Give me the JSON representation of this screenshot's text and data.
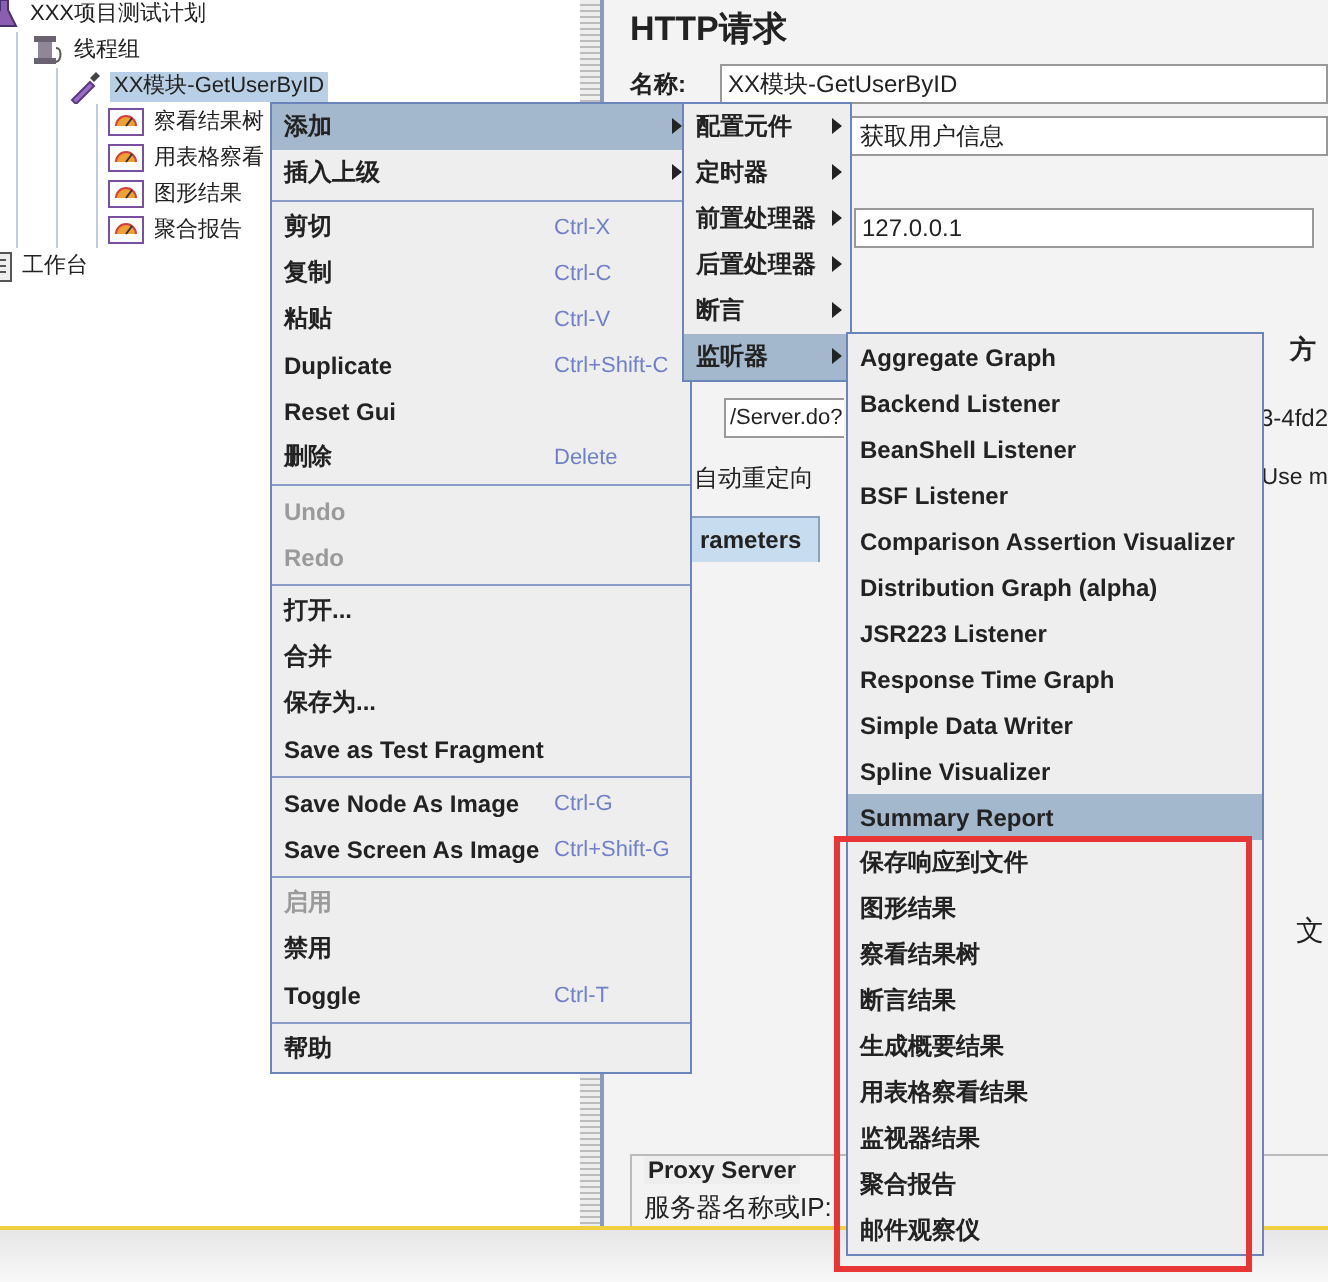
{
  "tree": [
    {
      "label": "XXX项目测试计划",
      "kind": "plan",
      "selected": false,
      "children": [
        {
          "label": "线程组",
          "kind": "threads",
          "selected": false,
          "children": [
            {
              "label": "XX模块-GetUserByID",
              "kind": "sampler",
              "selected": true,
              "children": [
                {
                  "label": "察看结果树",
                  "kind": "listener",
                  "selected": false
                },
                {
                  "label": "用表格察看",
                  "kind": "listener",
                  "selected": false
                },
                {
                  "label": "图形结果",
                  "kind": "listener",
                  "selected": false
                },
                {
                  "label": "聚合报告",
                  "kind": "listener",
                  "selected": false
                }
              ]
            }
          ]
        }
      ]
    },
    {
      "label": "工作台",
      "kind": "workbench",
      "selected": false
    }
  ],
  "http_request": {
    "title": "HTTP请求",
    "name_label": "名称:",
    "name_value": "XX模块-GetUserByID",
    "comment_value": "获取用户信息",
    "server_value": "127.0.0.1",
    "method_label": "方",
    "path_value": "/Server.do?",
    "path_tail": "3-4fd2",
    "redirect_label": "自动重定向",
    "multipart_label": "Use m",
    "tab_label": "rameters",
    "tab_selected": true,
    "file_label": "文",
    "proxy_title": "Proxy Server",
    "proxy_server_label": "服务器名称或IP:"
  },
  "context_menu": [
    {
      "kind": "submenu",
      "label": "添加",
      "selected": true,
      "disabled": false
    },
    {
      "kind": "submenu",
      "label": "插入上级",
      "selected": false,
      "disabled": false
    },
    {
      "kind": "separator"
    },
    {
      "kind": "item",
      "label": "剪切",
      "shortcut": "Ctrl-X",
      "selected": false,
      "disabled": false
    },
    {
      "kind": "item",
      "label": "复制",
      "shortcut": "Ctrl-C",
      "selected": false,
      "disabled": false
    },
    {
      "kind": "item",
      "label": "粘贴",
      "shortcut": "Ctrl-V",
      "selected": false,
      "disabled": false
    },
    {
      "kind": "item",
      "label": "Duplicate",
      "shortcut": "Ctrl+Shift-C",
      "selected": false,
      "disabled": false
    },
    {
      "kind": "item",
      "label": "Reset Gui",
      "selected": false,
      "disabled": false
    },
    {
      "kind": "item",
      "label": "删除",
      "shortcut": "Delete",
      "selected": false,
      "disabled": false
    },
    {
      "kind": "separator"
    },
    {
      "kind": "item",
      "label": "Undo",
      "selected": false,
      "disabled": true
    },
    {
      "kind": "item",
      "label": "Redo",
      "selected": false,
      "disabled": true
    },
    {
      "kind": "separator"
    },
    {
      "kind": "item",
      "label": "打开...",
      "selected": false,
      "disabled": false
    },
    {
      "kind": "item",
      "label": "合并",
      "selected": false,
      "disabled": false
    },
    {
      "kind": "item",
      "label": "保存为...",
      "selected": false,
      "disabled": false
    },
    {
      "kind": "item",
      "label": "Save as Test Fragment",
      "selected": false,
      "disabled": false
    },
    {
      "kind": "separator"
    },
    {
      "kind": "item",
      "label": "Save Node As Image",
      "shortcut": "Ctrl-G",
      "selected": false,
      "disabled": false
    },
    {
      "kind": "item",
      "label": "Save Screen As Image",
      "shortcut": "Ctrl+Shift-G",
      "selected": false,
      "disabled": false
    },
    {
      "kind": "separator"
    },
    {
      "kind": "item",
      "label": "启用",
      "selected": false,
      "disabled": true
    },
    {
      "kind": "item",
      "label": "禁用",
      "selected": false,
      "disabled": false
    },
    {
      "kind": "item",
      "label": "Toggle",
      "shortcut": "Ctrl-T",
      "selected": false,
      "disabled": false
    },
    {
      "kind": "separator"
    },
    {
      "kind": "item",
      "label": "帮助",
      "selected": false,
      "disabled": false
    }
  ],
  "add_menu": [
    {
      "kind": "submenu",
      "label": "配置元件",
      "selected": false,
      "disabled": false
    },
    {
      "kind": "submenu",
      "label": "定时器",
      "selected": false,
      "disabled": false
    },
    {
      "kind": "submenu",
      "label": "前置处理器",
      "selected": false,
      "disabled": false
    },
    {
      "kind": "submenu",
      "label": "后置处理器",
      "selected": false,
      "disabled": false
    },
    {
      "kind": "submenu",
      "label": "断言",
      "selected": false,
      "disabled": false
    },
    {
      "kind": "submenu",
      "label": "监听器",
      "selected": true,
      "disabled": false
    }
  ],
  "listener_menu": [
    {
      "kind": "item",
      "label": "Aggregate Graph",
      "selected": false,
      "disabled": false
    },
    {
      "kind": "item",
      "label": "Backend Listener",
      "selected": false,
      "disabled": false
    },
    {
      "kind": "item",
      "label": "BeanShell Listener",
      "selected": false,
      "disabled": false
    },
    {
      "kind": "item",
      "label": "BSF Listener",
      "selected": false,
      "disabled": false
    },
    {
      "kind": "item",
      "label": "Comparison Assertion Visualizer",
      "selected": false,
      "disabled": false
    },
    {
      "kind": "item",
      "label": "Distribution Graph (alpha)",
      "selected": false,
      "disabled": false
    },
    {
      "kind": "item",
      "label": "JSR223 Listener",
      "selected": false,
      "disabled": false
    },
    {
      "kind": "item",
      "label": "Response Time Graph",
      "selected": false,
      "disabled": false
    },
    {
      "kind": "item",
      "label": "Simple Data Writer",
      "selected": false,
      "disabled": false
    },
    {
      "kind": "item",
      "label": "Spline Visualizer",
      "selected": false,
      "disabled": false
    },
    {
      "kind": "item",
      "label": "Summary Report",
      "selected": true,
      "disabled": false
    },
    {
      "kind": "item",
      "label": "保存响应到文件",
      "selected": false,
      "disabled": false
    },
    {
      "kind": "item",
      "label": "图形结果",
      "selected": false,
      "disabled": false
    },
    {
      "kind": "item",
      "label": "察看结果树",
      "selected": false,
      "disabled": false
    },
    {
      "kind": "item",
      "label": "断言结果",
      "selected": false,
      "disabled": false
    },
    {
      "kind": "item",
      "label": "生成概要结果",
      "selected": false,
      "disabled": false
    },
    {
      "kind": "item",
      "label": "用表格察看结果",
      "selected": false,
      "disabled": false
    },
    {
      "kind": "item",
      "label": "监视器结果",
      "selected": false,
      "disabled": false
    },
    {
      "kind": "item",
      "label": "聚合报告",
      "selected": false,
      "disabled": false
    },
    {
      "kind": "item",
      "label": "邮件观察仪",
      "selected": false,
      "disabled": false
    }
  ]
}
